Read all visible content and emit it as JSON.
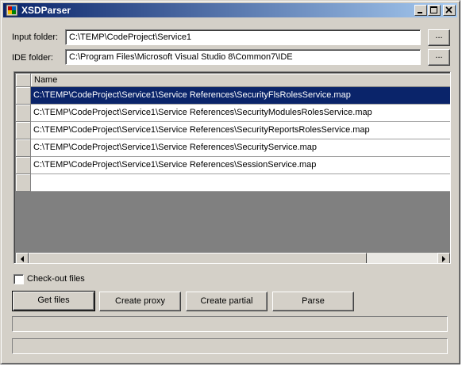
{
  "window": {
    "title": "XSDParser"
  },
  "input_folder": {
    "label": "Input folder:",
    "value": "C:\\TEMP\\CodeProject\\Service1",
    "browse_label": "..."
  },
  "ide_folder": {
    "label": "IDE folder:",
    "value": "C:\\Program Files\\Microsoft Visual Studio 8\\Common7\\IDE",
    "browse_label": "..."
  },
  "grid": {
    "column_header": "Name",
    "rows": [
      "C:\\TEMP\\CodeProject\\Service1\\Service References\\SecurityFlsRolesService.map",
      "C:\\TEMP\\CodeProject\\Service1\\Service References\\SecurityModulesRolesService.map",
      "C:\\TEMP\\CodeProject\\Service1\\Service References\\SecurityReportsRolesService.map",
      "C:\\TEMP\\CodeProject\\Service1\\Service References\\SecurityService.map",
      "C:\\TEMP\\CodeProject\\Service1\\Service References\\SessionService.map"
    ],
    "selected_row": 0
  },
  "checkout": {
    "label": "Check-out files",
    "checked": false
  },
  "buttons": {
    "get_files": "Get files",
    "create_proxy": "Create proxy",
    "create_partial": "Create partial",
    "parse": "Parse"
  },
  "progress": {
    "bar1": 0,
    "bar2": 0
  }
}
